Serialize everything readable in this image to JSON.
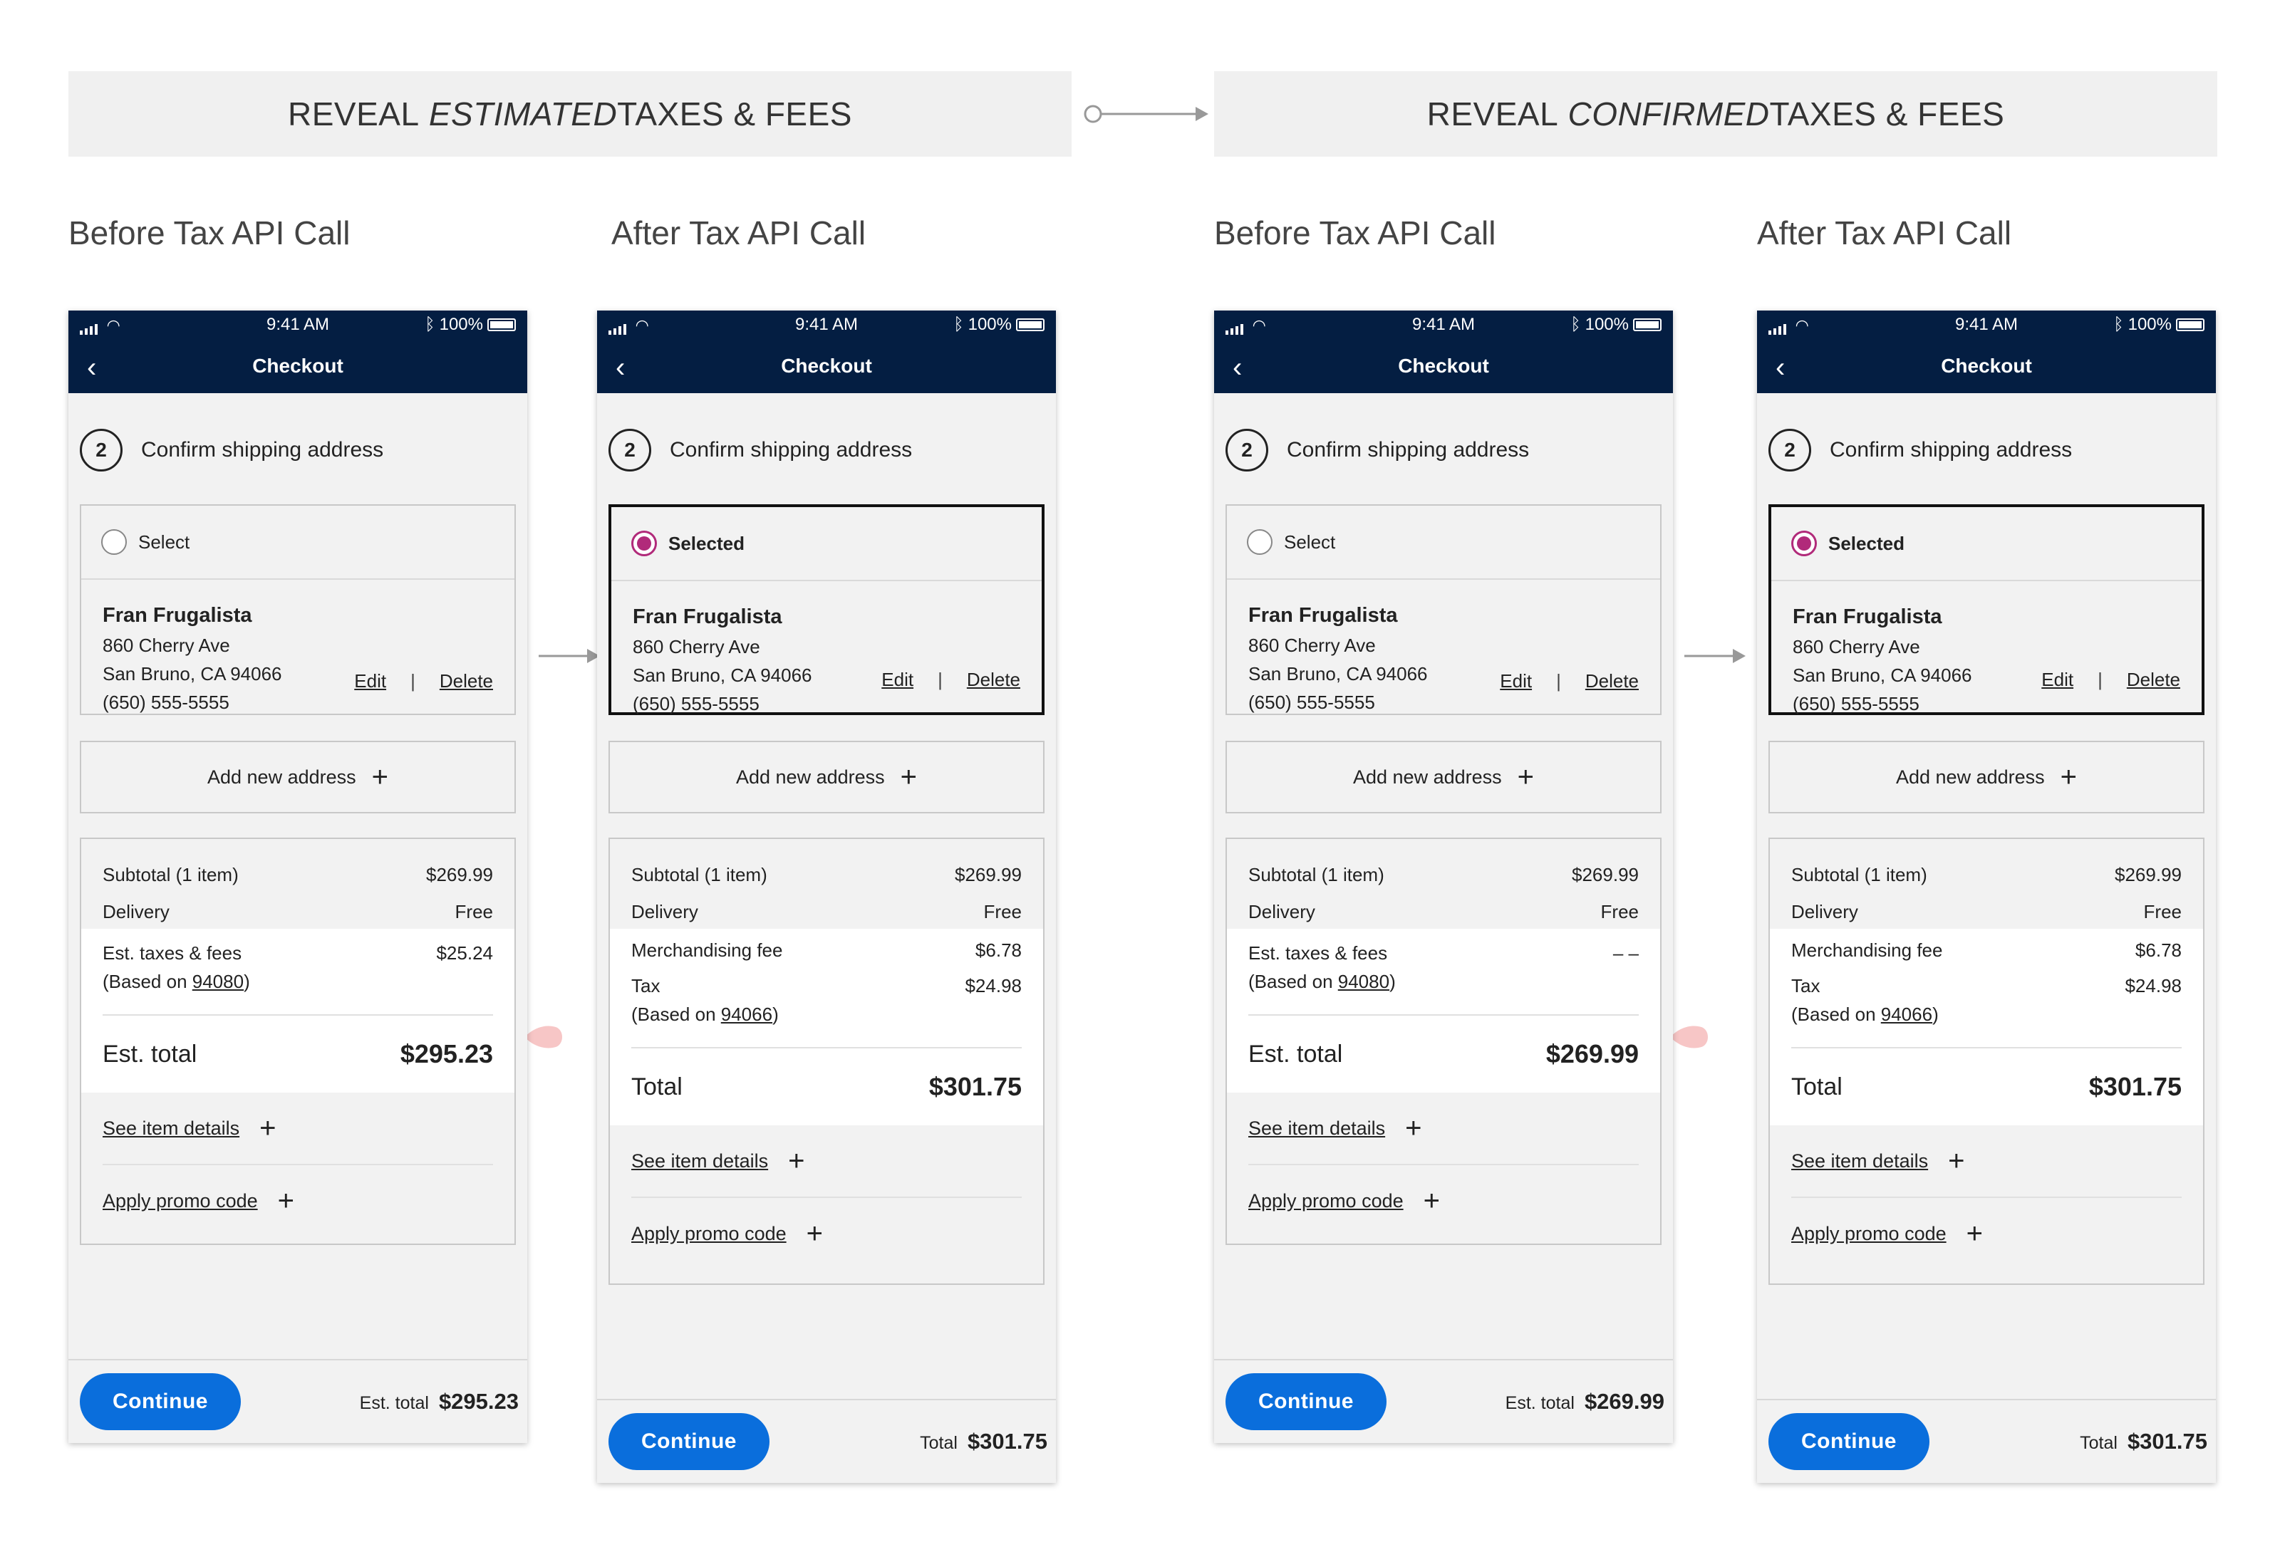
{
  "banners": {
    "left": {
      "pre": "REVEAL ",
      "emph": "ESTIMATED",
      "post": " TAXES & FEES"
    },
    "right": {
      "pre": "REVEAL ",
      "emph": "CONFIRMED",
      "post": " TAXES & FEES"
    }
  },
  "headings": [
    "Before Tax API Call",
    "After Tax API Call",
    "Before Tax API Call",
    "After Tax API Call"
  ],
  "status": {
    "time": "9:41 AM",
    "battery": "100%"
  },
  "nav_title": "Checkout",
  "step": {
    "number": "2",
    "label": "Confirm shipping address"
  },
  "address": {
    "select_label": "Select",
    "selected_label": "Selected",
    "name": "Fran Frugalista",
    "street": "860 Cherry Ave",
    "city": "San Bruno, CA 94066",
    "phone": "(650) 555-5555",
    "edit": "Edit",
    "sep": "|",
    "delete": "Delete"
  },
  "add_address": "Add new address",
  "summary": {
    "subtotal_label": "Subtotal (1 item)",
    "subtotal_value": "$269.99",
    "delivery_label": "Delivery",
    "delivery_value": "Free",
    "est_taxes_label": "Est. taxes & fees",
    "based_on_prefix": "(Based on ",
    "based_on_suffix": ")",
    "est_zip": "94080",
    "merch_label": "Merchandising fee",
    "merch_value": "$6.78",
    "tax_label": "Tax",
    "tax_value": "$24.98",
    "confirmed_zip": "94066",
    "see_items": "See item details",
    "promo": "Apply promo code"
  },
  "screens": {
    "s1": {
      "est_taxes_value": "$25.24",
      "total_label": "Est. total",
      "total_value": "$295.23",
      "footer_label": "Est. total",
      "footer_value": "$295.23"
    },
    "s2": {
      "total_label": "Total",
      "total_value": "$301.75",
      "footer_label": "Total",
      "footer_value": "$301.75"
    },
    "s3": {
      "est_taxes_value": "– –",
      "total_label": "Est. total",
      "total_value": "$269.99",
      "footer_label": "Est. total",
      "footer_value": "$269.99"
    },
    "s4": {
      "total_label": "Total",
      "total_value": "$301.75",
      "footer_label": "Total",
      "footer_value": "$301.75"
    }
  },
  "continue_label": "Continue",
  "colors": {
    "nav_bg": "#041e42",
    "continue_btn": "#0a6edc",
    "radio_selected": "#b12a7a",
    "highlight_pin": "#f7c6c6"
  }
}
